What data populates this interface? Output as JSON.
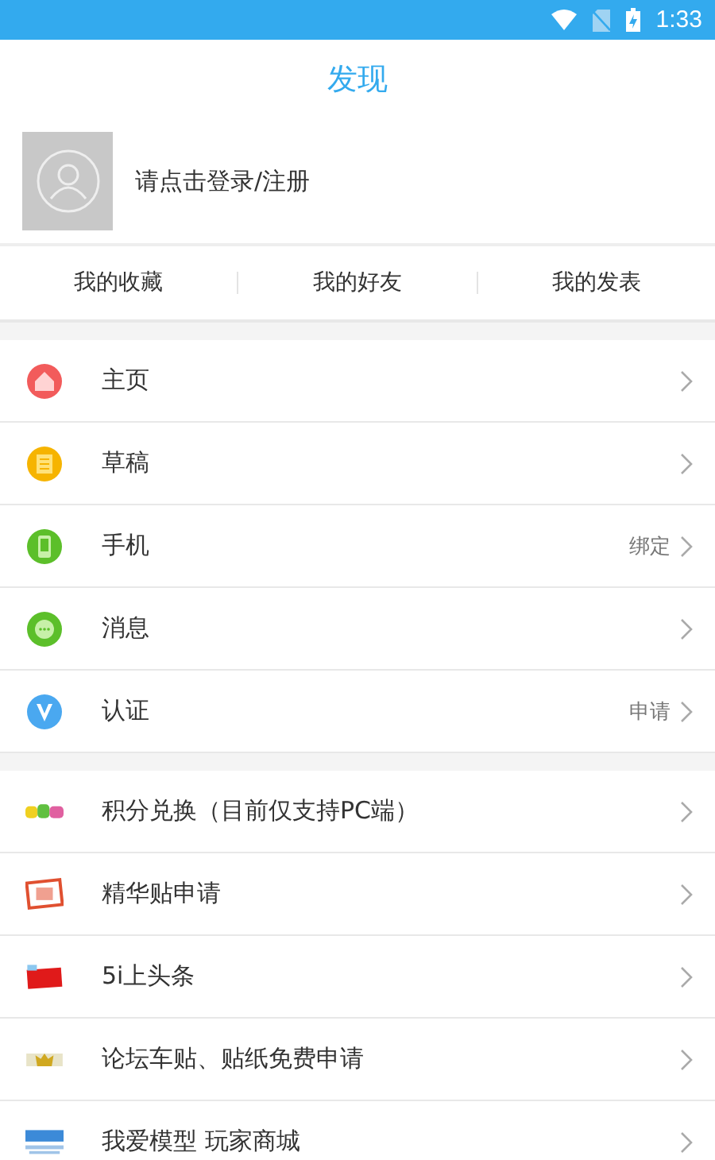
{
  "status_bar": {
    "time": "1:33"
  },
  "title": "发现",
  "profile": {
    "login_prompt": "请点击登录/注册"
  },
  "tabs": [
    {
      "label": "我的收藏"
    },
    {
      "label": "我的好友"
    },
    {
      "label": "我的发表"
    }
  ],
  "sections": [
    {
      "items": [
        {
          "kind": "home",
          "label": "主页"
        },
        {
          "kind": "draft",
          "label": "草稿"
        },
        {
          "kind": "phone",
          "label": "手机",
          "detail": "绑定"
        },
        {
          "kind": "message",
          "label": "消息"
        },
        {
          "kind": "verify",
          "label": "认证",
          "detail": "申请"
        }
      ]
    },
    {
      "items": [
        {
          "kind": "points",
          "label": "积分兑换（目前仅支持PC端）"
        },
        {
          "kind": "essence",
          "label": "精华贴申请"
        },
        {
          "kind": "headline",
          "label": "5i上头条"
        },
        {
          "kind": "sticker",
          "label": "论坛车贴、贴纸免费申请"
        },
        {
          "kind": "shop",
          "label": "我爱模型 玩家商城"
        }
      ]
    }
  ]
}
